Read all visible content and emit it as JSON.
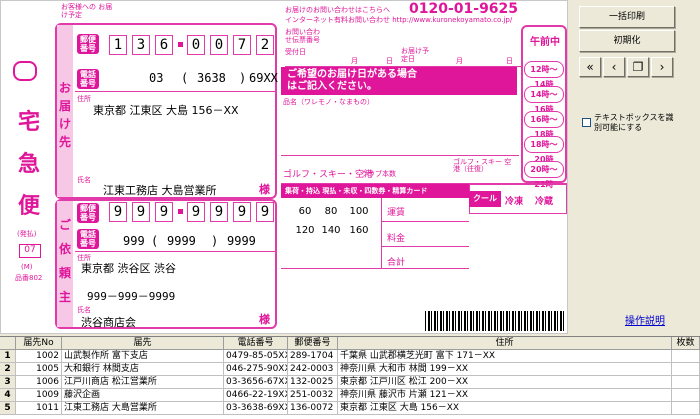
{
  "form": {
    "header_note": "お客様への お届け予定",
    "header_note2": "お届けのお問い合わせはこちらへ",
    "phone": "0120-01-9625",
    "url": "インターネット有料お問い合わせ http://www.kuronekoyamato.co.jp/",
    "inquiry_label": "お問い合わせ伝票番号",
    "received_date_label": "受付日",
    "scheduled_label": "お届け予定日",
    "month": "月",
    "day": "日",
    "brand_vertical": [
      "宅",
      "急",
      "便"
    ],
    "brand_sub": "(発払)",
    "form_code": "07",
    "form_code2": "(M)",
    "form_code3": "品番802",
    "recipient_vertical": [
      "お",
      "届",
      "け",
      "先"
    ],
    "sender_vertical": [
      "ご",
      "依",
      "頼",
      "主"
    ],
    "postal_label": "郵便番号",
    "phone_label": "電話番号",
    "address_label": "住所",
    "name_label": "氏名",
    "sama": "様",
    "recipient": {
      "postal": [
        "1",
        "3",
        "6",
        "0",
        "0",
        "7",
        "2"
      ],
      "phone_area": "03",
      "phone_mid": "3638",
      "phone_last": "69XX",
      "address": "東京都 江東区 大島 156－XX",
      "name": "江東工務店 大島営業所"
    },
    "sender": {
      "postal": [
        "9",
        "9",
        "9",
        "9",
        "9",
        "9",
        "9"
      ],
      "phone_area": "999",
      "phone_mid": "9999",
      "phone_last": "9999",
      "address": "東京都 渋谷区 渋谷",
      "phone2": "999－999－9999",
      "name": "渋谷商店会"
    },
    "delivery_prompt": "ご希望のお届け日がある場合はご記入ください。",
    "time_header": "午前中",
    "time_slots": [
      "12時～14時",
      "14時～16時",
      "16時～18時",
      "18時～20時",
      "20時～21時"
    ],
    "item_label": "品名（ワレモノ・なまもの）",
    "golf_label": "ゴルフ・スキー・空港",
    "club_label": "クラブ本数",
    "golf_small": "ゴルフ・スキー 空港（往復）",
    "fee_header": "集荷・持込 現払・未収・四数券・精算カード",
    "sizes": [
      "60",
      "80",
      "100",
      "120",
      "140",
      "160"
    ],
    "fee_labels": [
      "運賃",
      "料金",
      "合計"
    ],
    "cool_label": "クール",
    "cool_options": [
      "冷凍",
      "冷蔵"
    ],
    "yamato_link": "操作説明"
  },
  "toolbar": {
    "print_all": "一括印刷",
    "reset": "初期化",
    "nav_first": "«",
    "nav_prev": "‹",
    "nav_window": "❐",
    "nav_next": "›",
    "checkbox_label": "テキストボックスを識別可能にする"
  },
  "grid": {
    "headers": [
      "",
      "届先No",
      "届先",
      "電話番号",
      "郵便番号",
      "住所",
      "枚数"
    ],
    "rows": [
      [
        "1",
        "1002",
        "山武製作所 富下支店",
        "0479-85-05XX",
        "289-1704",
        "千葉県 山武郡横芝光町 富下 171－XX",
        ""
      ],
      [
        "2",
        "1005",
        "大和銀行 林間支店",
        "046-275-90XX",
        "242-0003",
        "神奈川県 大和市 林間 199－XX",
        ""
      ],
      [
        "3",
        "1006",
        "江戸川商店 松江営業所",
        "03-3656-67XX",
        "132-0025",
        "東京都 江戸川区 松江 200－XX",
        ""
      ],
      [
        "4",
        "1009",
        "藤沢企画",
        "0466-22-19XX",
        "251-0032",
        "神奈川県 藤沢市 片瀬 121－XX",
        ""
      ],
      [
        "5",
        "1011",
        "江東工務店 大島営業所",
        "03-3638-69XX",
        "136-0072",
        "東京都 江東区 大島 156－XX",
        ""
      ]
    ]
  }
}
